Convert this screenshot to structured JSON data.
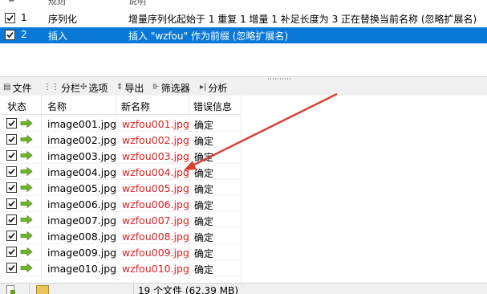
{
  "rules": {
    "header": {
      "col_number": "#",
      "col_rule": "规则",
      "col_description": "说明"
    },
    "items": [
      {
        "checked": true,
        "number": "1",
        "name": "序列化",
        "description": "增量序列化起始于 1 重复 1 增量 1 补足长度为 3 正在替换当前名称 (忽略扩展名)",
        "selected": false
      },
      {
        "checked": true,
        "number": "2",
        "name": "插入",
        "description": "插入 \"wzfou\" 作为前缀 (忽略扩展名)",
        "selected": true
      }
    ]
  },
  "toolbar": {
    "items": [
      {
        "label": "文件",
        "icon": "menu-icon"
      },
      {
        "label": "分栏",
        "icon": "columns-icon"
      },
      {
        "label": "选项",
        "icon": "options-icon"
      },
      {
        "label": "导出",
        "icon": "export-icon"
      },
      {
        "label": "筛选器",
        "icon": "filter-icon"
      },
      {
        "label": "分析",
        "icon": "analyze-icon"
      }
    ]
  },
  "files": {
    "headers": {
      "status": "状态",
      "name": "名称",
      "new_name": "新名称",
      "error": "错误信息"
    },
    "rows": [
      {
        "name": "image001.jpg",
        "new_name": "wzfou001.jpg",
        "error": "确定"
      },
      {
        "name": "image002.jpg",
        "new_name": "wzfou002.jpg",
        "error": "确定"
      },
      {
        "name": "image003.jpg",
        "new_name": "wzfou003.jpg",
        "error": "确定"
      },
      {
        "name": "image004.jpg",
        "new_name": "wzfou004.jpg",
        "error": "确定"
      },
      {
        "name": "image005.jpg",
        "new_name": "wzfou005.jpg",
        "error": "确定"
      },
      {
        "name": "image006.jpg",
        "new_name": "wzfou006.jpg",
        "error": "确定"
      },
      {
        "name": "image007.jpg",
        "new_name": "wzfou007.jpg",
        "error": "确定"
      },
      {
        "name": "image008.jpg",
        "new_name": "wzfou008.jpg",
        "error": "确定"
      },
      {
        "name": "image009.jpg",
        "new_name": "wzfou009.jpg",
        "error": "确定"
      },
      {
        "name": "image010.jpg",
        "new_name": "wzfou010.jpg",
        "error": "确定"
      }
    ]
  },
  "statusbar": {
    "file_count": "19 个文件 (62.39 MB)"
  },
  "colors": {
    "selection": "#0a78d7",
    "new_name": "#e02020",
    "arrow_green": "#6fb52c",
    "annotation": "#d9402f"
  }
}
